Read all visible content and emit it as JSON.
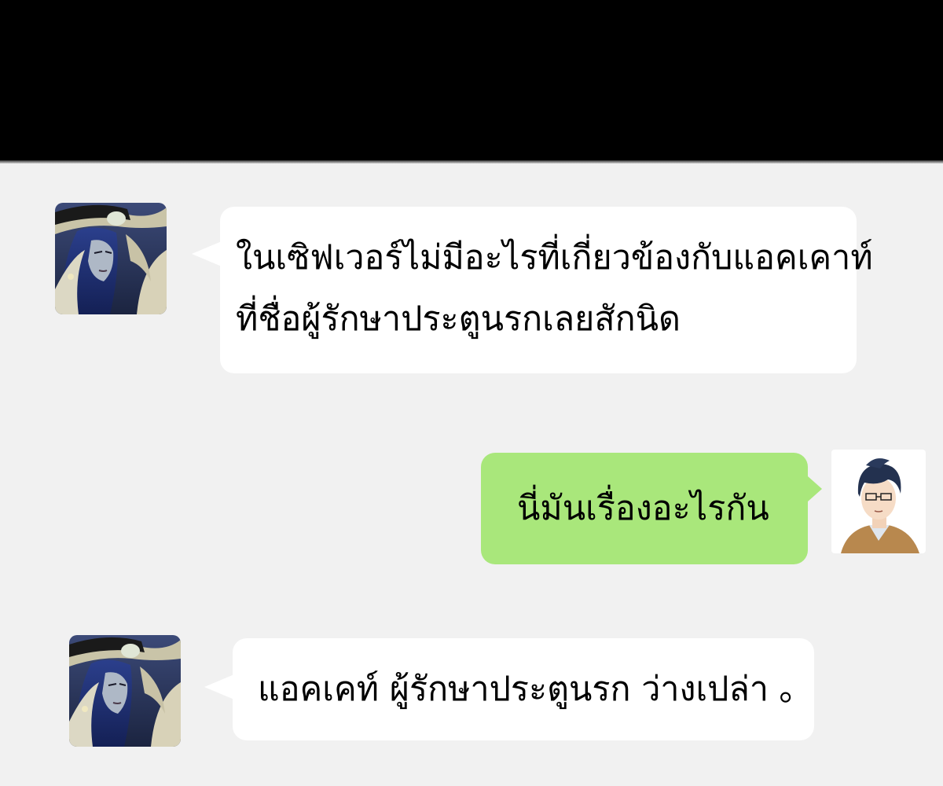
{
  "chat": {
    "messages": [
      {
        "side": "left",
        "avatar": "hooded-villain-avatar",
        "line1": "ในเซิฟเวอร์ไม่มีอะไรที่เกี่ยวข้องกับแอคเคาท์",
        "line2": "ที่ชื่อผู้รักษาประตูนรกเลยสักนิด"
      },
      {
        "side": "right",
        "avatar": "young-man-avatar",
        "text": "นี่มันเรื่องอะไรกัน"
      },
      {
        "side": "left",
        "avatar": "hooded-villain-avatar",
        "text": "แอคเคท์ ผู้รักษาประตูนรก ว่างเปล่า ｡"
      }
    ]
  },
  "colors": {
    "top_bar": "#000000",
    "background": "#f1f1f1",
    "incoming_bubble": "#ffffff",
    "outgoing_bubble": "#a9e77b"
  }
}
